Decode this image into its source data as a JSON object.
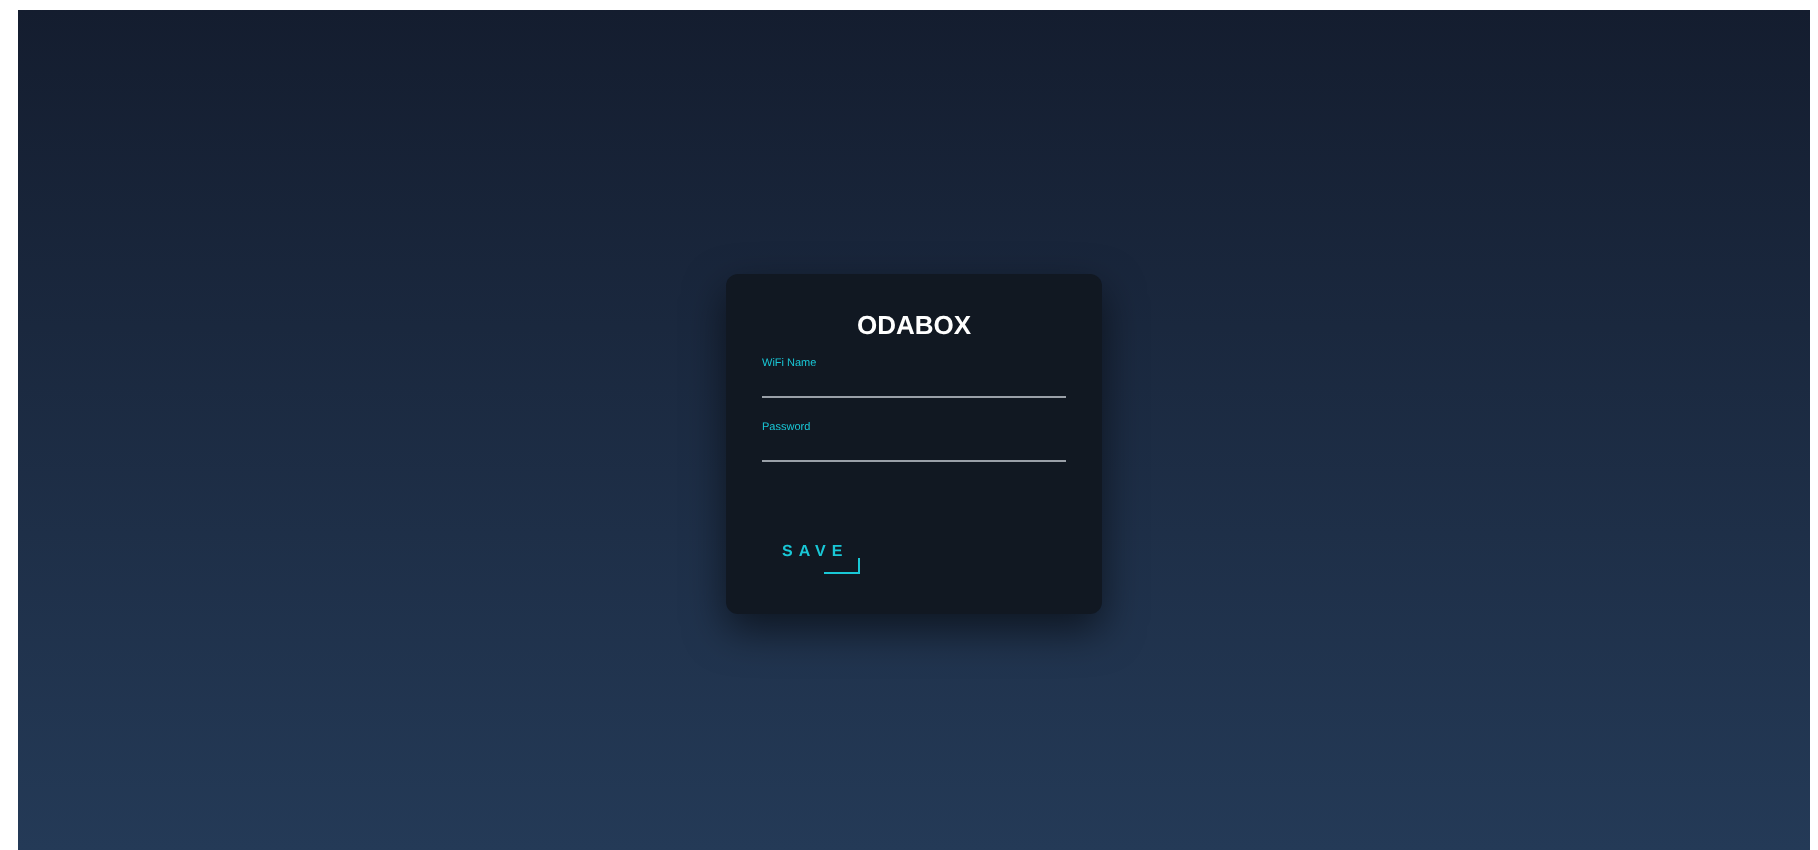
{
  "title": "ODABOX",
  "fields": [
    {
      "label": "WiFi Name"
    },
    {
      "label": "Password"
    }
  ],
  "button": "SAVE"
}
